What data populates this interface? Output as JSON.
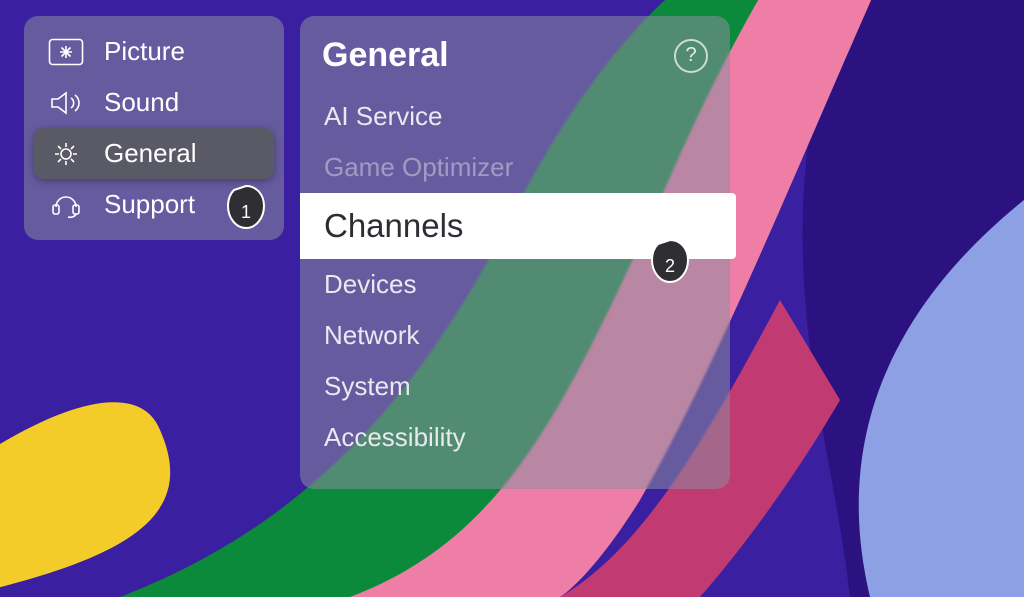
{
  "sidebar": {
    "items": [
      {
        "label": "Picture",
        "selected": false
      },
      {
        "label": "Sound",
        "selected": false
      },
      {
        "label": "General",
        "selected": true
      },
      {
        "label": "Support",
        "selected": false
      }
    ]
  },
  "submenu": {
    "title": "General",
    "help_glyph": "?",
    "items": [
      {
        "label": "AI Service",
        "state": "normal"
      },
      {
        "label": "Game Optimizer",
        "state": "disabled"
      },
      {
        "label": "Channels",
        "state": "highlight"
      },
      {
        "label": "Devices",
        "state": "normal"
      },
      {
        "label": "Network",
        "state": "normal"
      },
      {
        "label": "System",
        "state": "normal"
      },
      {
        "label": "Accessibility",
        "state": "normal"
      }
    ]
  },
  "callouts": {
    "first": "1",
    "second": "2"
  }
}
